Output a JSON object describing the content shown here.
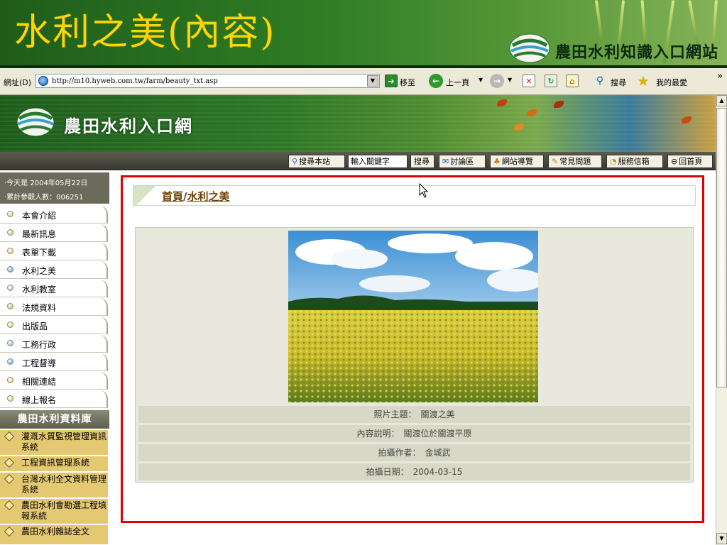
{
  "slide": {
    "title": "水利之美(內容)",
    "site_name": "農田水利知識入口網站"
  },
  "browser": {
    "address_label": "網址(D)",
    "url": "http://m10.hyweb.com.tw/farm/beauty_txt.asp",
    "go_label": "移至",
    "back_label": "上一頁",
    "search_label": "搜尋",
    "favorites_label": "我的最愛",
    "more_label": "»"
  },
  "site": {
    "title": "農田水利入口網",
    "nav": {
      "search_site": "搜尋本站",
      "keyword_input": "輸入關鍵字",
      "search_button": "搜尋",
      "forum": "討論區",
      "sitemap": "網站導覽",
      "faq": "常見問題",
      "mailbox": "服務信箱",
      "home": "回首頁"
    }
  },
  "sidebar": {
    "today": "‧今天是 2004年05月22日",
    "visits": "‧累計參觀人數：006251",
    "menu": [
      {
        "label": "本會介紹",
        "color": "#d8c238"
      },
      {
        "label": "最新訊息",
        "color": "#b8c23a"
      },
      {
        "label": "表單下載",
        "color": "#e8c23a"
      },
      {
        "label": "水利之美",
        "color": "#4a8ed0"
      },
      {
        "label": "水利教室",
        "color": "#e0a0b8"
      },
      {
        "label": "法規資料",
        "color": "#9ac23a"
      },
      {
        "label": "出版品",
        "color": "#e8c23a"
      },
      {
        "label": "工務行政",
        "color": "#7aaee0"
      },
      {
        "label": "工程督導",
        "color": "#4a8ed0"
      },
      {
        "label": "相關連結",
        "color": "#e8c23a"
      },
      {
        "label": "線上報名",
        "color": "#e8c23a"
      }
    ],
    "database_title": "農田水利資料庫",
    "databases": [
      "灌溉水質監視管理資訊系統",
      "工程資訊管理系統",
      "台灣水利全文資料管理系統",
      "農田水利會勘選工程填報系統",
      "農田水利雜誌全文"
    ]
  },
  "content": {
    "breadcrumb_home": "首頁",
    "breadcrumb_sep": "/",
    "breadcrumb_current": "水利之美",
    "rows": [
      {
        "label": "照片主題：",
        "value": "關渡之美"
      },
      {
        "label": "內容說明：",
        "value": "關渡位於關渡平原"
      },
      {
        "label": "拍攝作者：",
        "value": "金城武"
      },
      {
        "label": "拍攝日期：",
        "value": "2004-03-15"
      }
    ]
  }
}
